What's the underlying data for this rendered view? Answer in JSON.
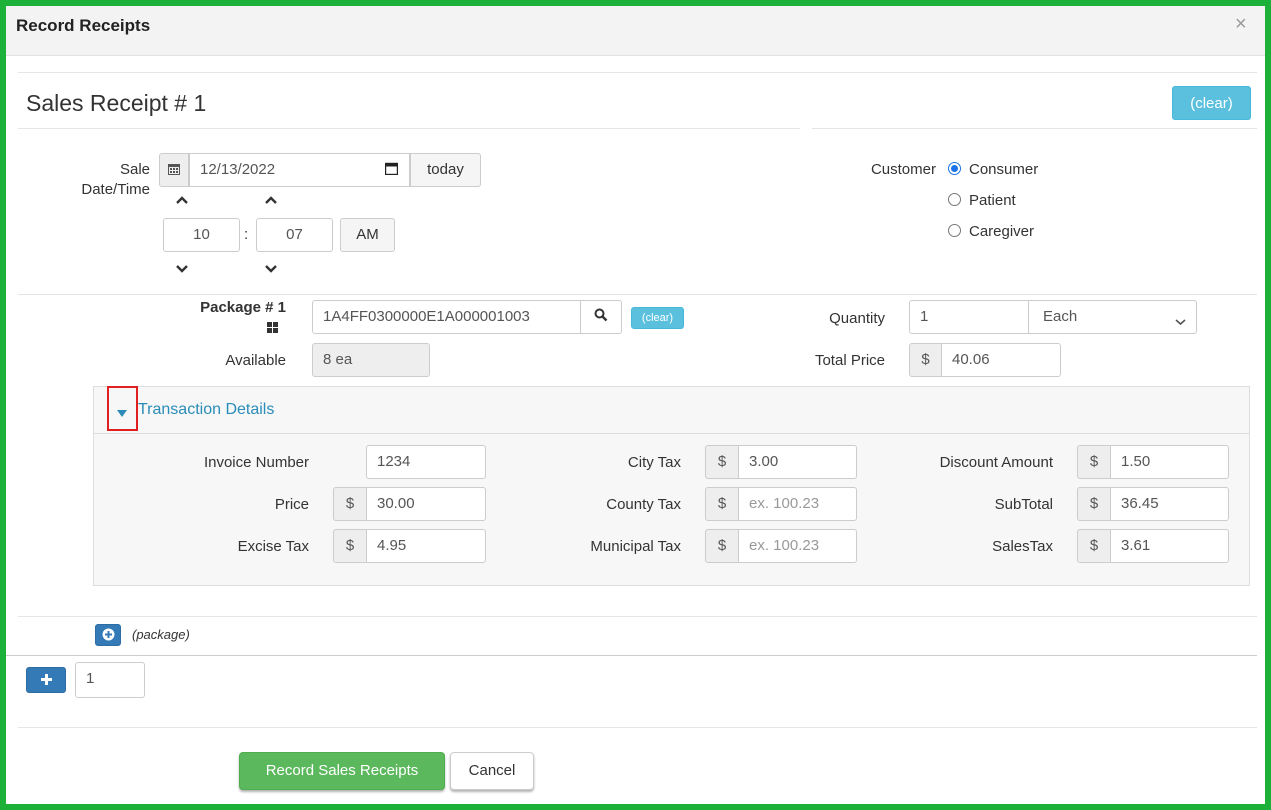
{
  "modal": {
    "title": "Record Receipts",
    "close_label": "×"
  },
  "receipt": {
    "title": "Sales Receipt # 1",
    "clear_label": "(clear)"
  },
  "sale_datetime": {
    "label_line1": "Sale",
    "label_line2": "Date/Time",
    "date_value": "12/13/2022",
    "today_label": "today",
    "hour": "10",
    "separator": ":",
    "minute": "07",
    "ampm": "AM"
  },
  "customer": {
    "label": "Customer",
    "options": [
      "Consumer",
      "Patient",
      "Caregiver"
    ],
    "selected": "Consumer"
  },
  "package": {
    "label": "Package # 1",
    "tag_value": "1A4FF0300000E1A000001003",
    "clear_label": "(clear)",
    "available_label": "Available",
    "available_value": "8 ea",
    "quantity_label": "Quantity",
    "quantity_value": "1",
    "unit_value": "Each",
    "total_price_label": "Total Price",
    "total_price_value": "40.06",
    "currency": "$"
  },
  "transaction": {
    "header_label": "Transaction Details",
    "invoice_number_label": "Invoice Number",
    "invoice_number_value": "1234",
    "price_label": "Price",
    "price_value": "30.00",
    "excise_tax_label": "Excise Tax",
    "excise_tax_value": "4.95",
    "city_tax_label": "City Tax",
    "city_tax_value": "3.00",
    "county_tax_label": "County Tax",
    "county_tax_placeholder": "ex. 100.23",
    "municipal_tax_label": "Municipal Tax",
    "municipal_tax_placeholder": "ex. 100.23",
    "discount_amount_label": "Discount Amount",
    "discount_amount_value": "1.50",
    "subtotal_label": "SubTotal",
    "subtotal_value": "36.45",
    "sales_tax_label": "SalesTax",
    "sales_tax_value": "3.61"
  },
  "add_package": {
    "label": "(package)"
  },
  "add_receipt": {
    "count_value": "1"
  },
  "footer": {
    "record_label": "Record Sales Receipts",
    "cancel_label": "Cancel"
  },
  "colors": {
    "frame": "#1db13a",
    "info": "#5bc0de",
    "primary": "#337ab7",
    "success": "#5cb85c",
    "highlight": "#e02020"
  }
}
